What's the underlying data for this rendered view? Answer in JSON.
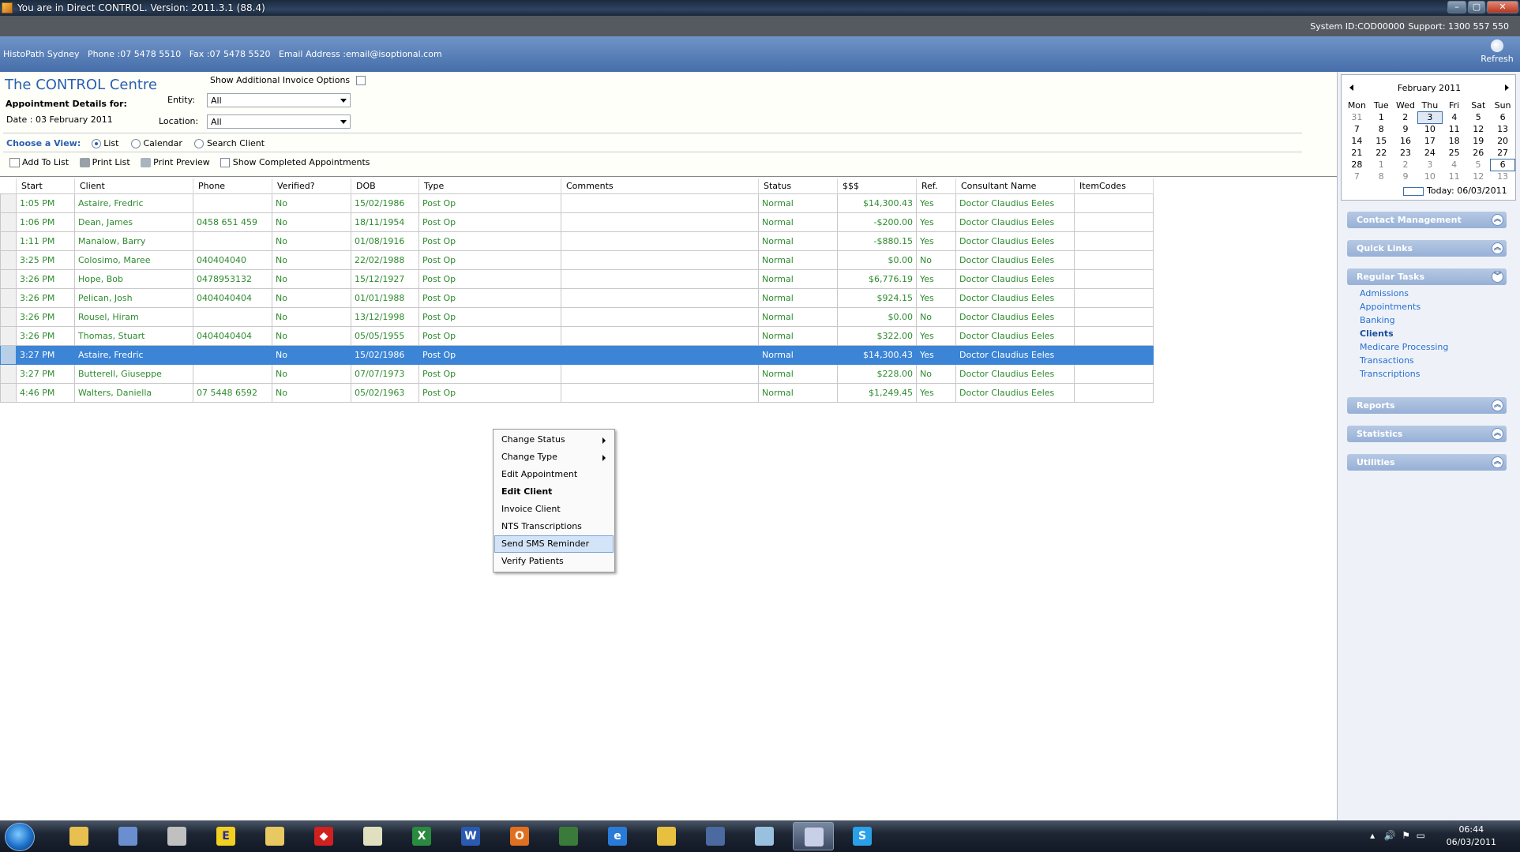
{
  "window": {
    "title": "You are in Direct CONTROL. Version: 2011.3.1 (88.4)",
    "buttons": [
      "–",
      "▢",
      "✕"
    ]
  },
  "sysbar": {
    "system_id": "System ID:COD00000",
    "support": "Support: 1300 557 550"
  },
  "infobar": {
    "text": "HistoPath Sydney   Phone :07 5478 5510   Fax :07 5478 5520   Email Address :email@isoptional.com",
    "refresh_label": "Refresh"
  },
  "header": {
    "title": "The CONTROL Centre",
    "appt_details": "Appointment Details for:",
    "date": "Date : 03 February 2011",
    "show_invoice_options": "Show Additional Invoice Options",
    "entity_label": "Entity:",
    "entity_value": "All",
    "location_label": "Location:",
    "location_value": "All"
  },
  "view": {
    "label": "Choose a View:",
    "options": [
      "List",
      "Calendar",
      "Search Client"
    ],
    "selected": "List"
  },
  "toolbar": {
    "add_to_list": "Add To List",
    "print_list": "Print List",
    "print_preview": "Print Preview",
    "show_completed": "Show Completed Appointments"
  },
  "grid": {
    "columns": [
      "Start",
      "Client",
      "Phone",
      "Verified?",
      "DOB",
      "Type",
      "Comments",
      "Status",
      "$$$",
      "Ref.",
      "Consultant Name",
      "ItemCodes"
    ],
    "rows": [
      [
        "1:05 PM",
        "Astaire, Fredric",
        "",
        "No",
        "15/02/1986",
        "Post Op",
        "",
        "Normal",
        "$14,300.43",
        "Yes",
        "Doctor Claudius Eeles",
        ""
      ],
      [
        "1:06 PM",
        "Dean, James",
        "0458 651 459",
        "No",
        "18/11/1954",
        "Post Op",
        "",
        "Normal",
        "-$200.00",
        "Yes",
        "Doctor Claudius Eeles",
        ""
      ],
      [
        "1:11 PM",
        "Manalow, Barry",
        "",
        "No",
        "01/08/1916",
        "Post Op",
        "",
        "Normal",
        "-$880.15",
        "Yes",
        "Doctor Claudius Eeles",
        ""
      ],
      [
        "3:25 PM",
        "Colosimo, Maree",
        "040404040",
        "No",
        "22/02/1988",
        "Post Op",
        "",
        "Normal",
        "$0.00",
        "No",
        "Doctor Claudius Eeles",
        ""
      ],
      [
        "3:26 PM",
        "Hope, Bob",
        "0478953132",
        "No",
        "15/12/1927",
        "Post Op",
        "",
        "Normal",
        "$6,776.19",
        "Yes",
        "Doctor Claudius Eeles",
        ""
      ],
      [
        "3:26 PM",
        "Pelican, Josh",
        "0404040404",
        "No",
        "01/01/1988",
        "Post Op",
        "",
        "Normal",
        "$924.15",
        "Yes",
        "Doctor Claudius Eeles",
        ""
      ],
      [
        "3:26 PM",
        "Rousel, Hiram",
        "",
        "No",
        "13/12/1998",
        "Post Op",
        "",
        "Normal",
        "$0.00",
        "No",
        "Doctor Claudius Eeles",
        ""
      ],
      [
        "3:26 PM",
        "Thomas, Stuart",
        "0404040404",
        "No",
        "05/05/1955",
        "Post Op",
        "",
        "Normal",
        "$322.00",
        "Yes",
        "Doctor Claudius Eeles",
        ""
      ],
      [
        "3:27 PM",
        "Astaire, Fredric",
        "",
        "No",
        "15/02/1986",
        "Post Op",
        "",
        "Normal",
        "$14,300.43",
        "Yes",
        "Doctor Claudius Eeles",
        ""
      ],
      [
        "3:27 PM",
        "Butterell, Giuseppe",
        "",
        "No",
        "07/07/1973",
        "Post Op",
        "",
        "Normal",
        "$228.00",
        "No",
        "Doctor Claudius Eeles",
        ""
      ],
      [
        "4:46 PM",
        "Walters, Daniella",
        "07 5448 6592",
        "No",
        "05/02/1963",
        "Post Op",
        "",
        "Normal",
        "$1,249.45",
        "Yes",
        "Doctor Claudius Eeles",
        ""
      ]
    ],
    "selected_row": 8
  },
  "context_menu": {
    "items": [
      {
        "label": "Change Status",
        "submenu": true
      },
      {
        "label": "Change Type",
        "submenu": true
      },
      {
        "label": "Edit Appointment"
      },
      {
        "label": "Edit Client",
        "bold": true
      },
      {
        "label": "Invoice Client"
      },
      {
        "label": "NTS Transcriptions"
      },
      {
        "label": "Send SMS Reminder",
        "highlighted": true
      },
      {
        "label": "Verify Patients"
      }
    ]
  },
  "calendar": {
    "month": "February 2011",
    "days": [
      "Mon",
      "Tue",
      "Wed",
      "Thu",
      "Fri",
      "Sat",
      "Sun"
    ],
    "weeks": [
      [
        "31",
        "1",
        "2",
        "3",
        "4",
        "5",
        "6"
      ],
      [
        "7",
        "8",
        "9",
        "10",
        "11",
        "12",
        "13"
      ],
      [
        "14",
        "15",
        "16",
        "17",
        "18",
        "19",
        "20"
      ],
      [
        "21",
        "22",
        "23",
        "24",
        "25",
        "26",
        "27"
      ],
      [
        "28",
        "1",
        "2",
        "3",
        "4",
        "5",
        "6"
      ],
      [
        "7",
        "8",
        "9",
        "10",
        "11",
        "12",
        "13"
      ]
    ],
    "today_label": "Today: 06/03/2011"
  },
  "sidebar": {
    "panels": [
      "Contact Management",
      "Quick Links",
      "Regular Tasks",
      "Reports",
      "Statistics",
      "Utilities"
    ],
    "regular_tasks": [
      "Admissions",
      "Appointments",
      "Banking",
      "Clients",
      "Medicare Processing",
      "Transactions",
      "Transcriptions"
    ],
    "active_task": "Clients"
  },
  "taskbar": {
    "apps": [
      "explorer",
      "paint",
      "snipping",
      "editor-e",
      "folder",
      "red-app",
      "notepad",
      "excel",
      "word",
      "outlook",
      "monitor",
      "ie",
      "keys",
      "network",
      "notebook",
      "control-app",
      "skype"
    ],
    "time": "06:44",
    "date": "06/03/2011"
  }
}
